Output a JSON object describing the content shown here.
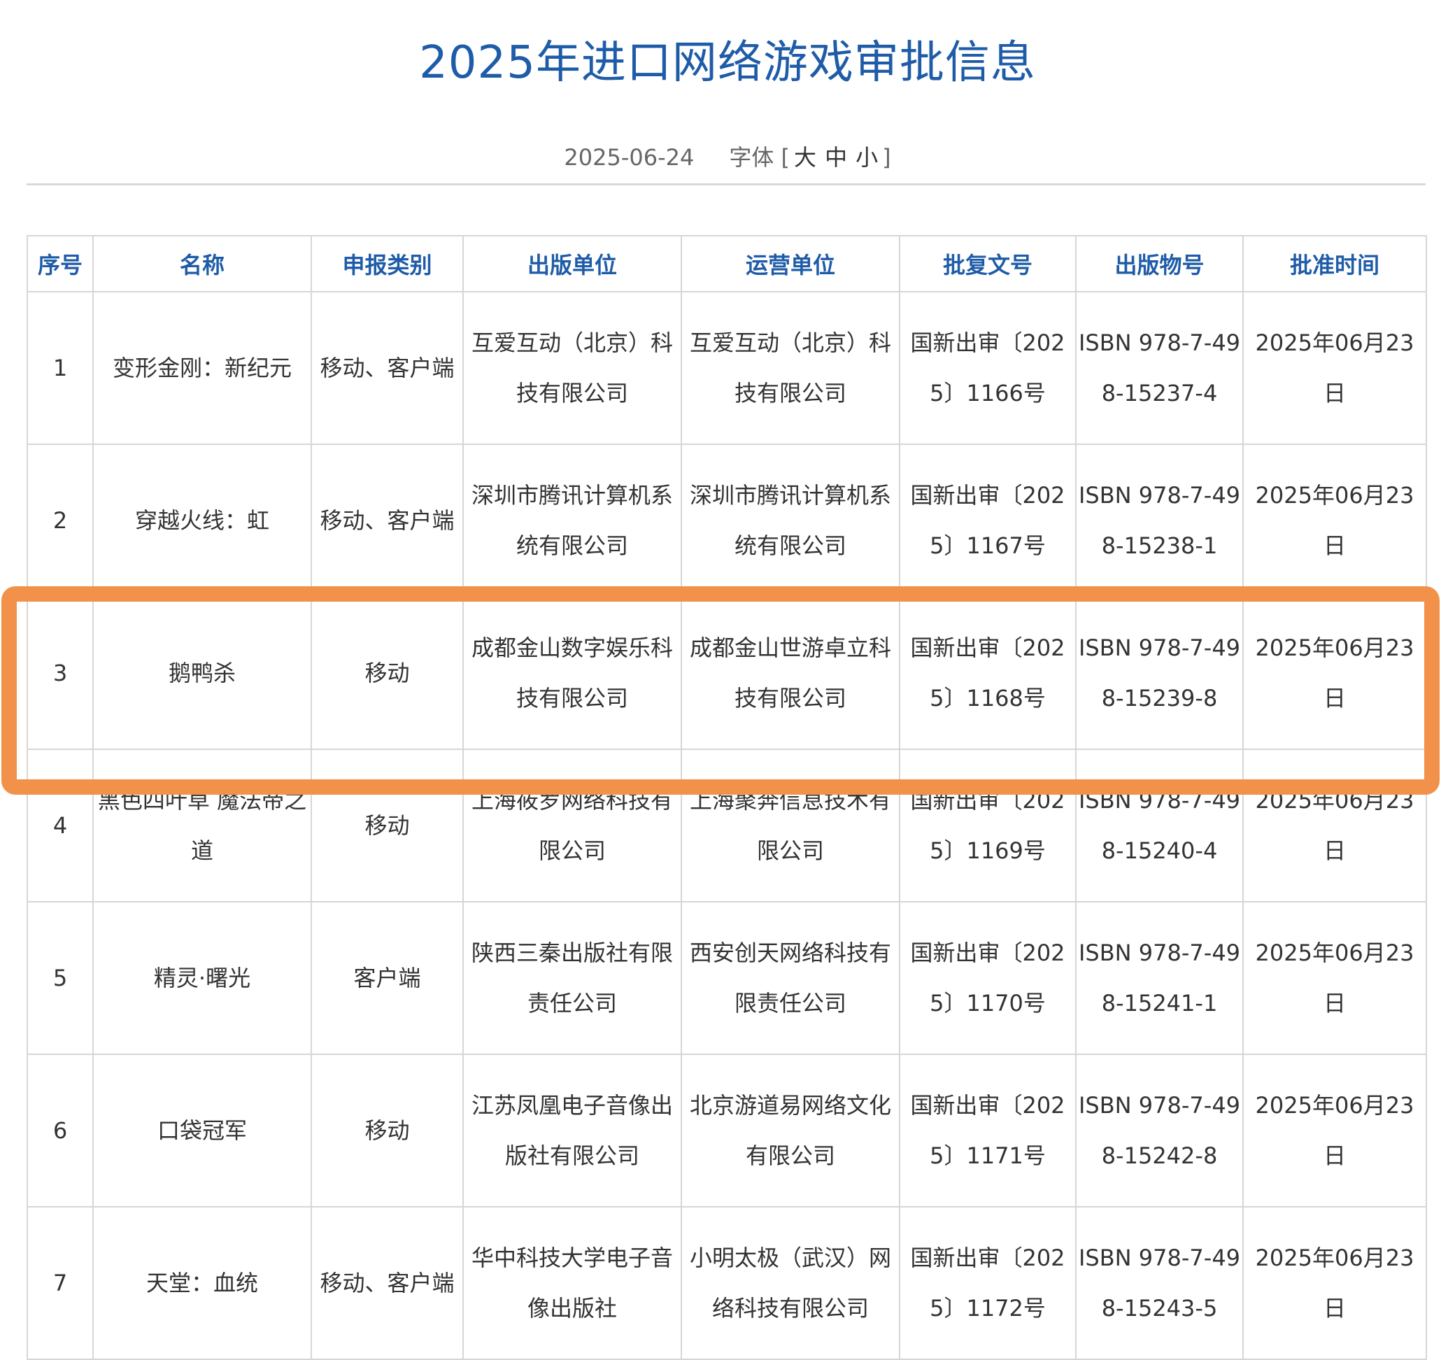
{
  "header": {
    "title": "2025年进口网络游戏审批信息",
    "date": "2025-06-24",
    "font_size_label": "字体 [",
    "font_size_large": "大",
    "font_size_medium": "中",
    "font_size_small": "小",
    "font_size_close": "]"
  },
  "table": {
    "columns": [
      "序号",
      "名称",
      "申报类别",
      "出版单位",
      "运营单位",
      "批复文号",
      "出版物号",
      "批准时间"
    ],
    "rows": [
      [
        "1",
        "变形金刚：新纪元",
        "移动、客户端",
        "互爱互动（北京）科技有限公司",
        "互爱互动（北京）科技有限公司",
        "国新出审〔2025〕1166号",
        "ISBN 978-7-498-15237-4",
        "2025年06月23日"
      ],
      [
        "2",
        "穿越火线：虹",
        "移动、客户端",
        "深圳市腾讯计算机系统有限公司",
        "深圳市腾讯计算机系统有限公司",
        "国新出审〔2025〕1167号",
        "ISBN 978-7-498-15238-1",
        "2025年06月23日"
      ],
      [
        "3",
        "鹅鸭杀",
        "移动",
        "成都金山数字娱乐科技有限公司",
        "成都金山世游卓立科技有限公司",
        "国新出审〔2025〕1168号",
        "ISBN 978-7-498-15239-8",
        "2025年06月23日"
      ],
      [
        "4",
        "黑色四叶草 魔法帝之道",
        "移动",
        "上海莜罗网络科技有限公司",
        "上海聚奔信息技术有限公司",
        "国新出审〔2025〕1169号",
        "ISBN 978-7-498-15240-4",
        "2025年06月23日"
      ],
      [
        "5",
        "精灵·曙光",
        "客户端",
        "陕西三秦出版社有限责任公司",
        "西安创天网络科技有限责任公司",
        "国新出审〔2025〕1170号",
        "ISBN 978-7-498-15241-1",
        "2025年06月23日"
      ],
      [
        "6",
        "口袋冠军",
        "移动",
        "江苏凤凰电子音像出版社有限公司",
        "北京游道易网络文化有限公司",
        "国新出审〔2025〕1171号",
        "ISBN 978-7-498-15242-8",
        "2025年06月23日"
      ],
      [
        "7",
        "天堂：血统",
        "移动、客户端",
        "华中科技大学电子音像出版社",
        "小明太极（武汉）网络科技有限公司",
        "国新出审〔2025〕1172号",
        "ISBN 978-7-498-15243-5",
        "2025年06月23日"
      ]
    ]
  },
  "colors": {
    "accent": "#1f5ca8",
    "highlight": "#f2924a",
    "border": "#d6d6d6"
  }
}
